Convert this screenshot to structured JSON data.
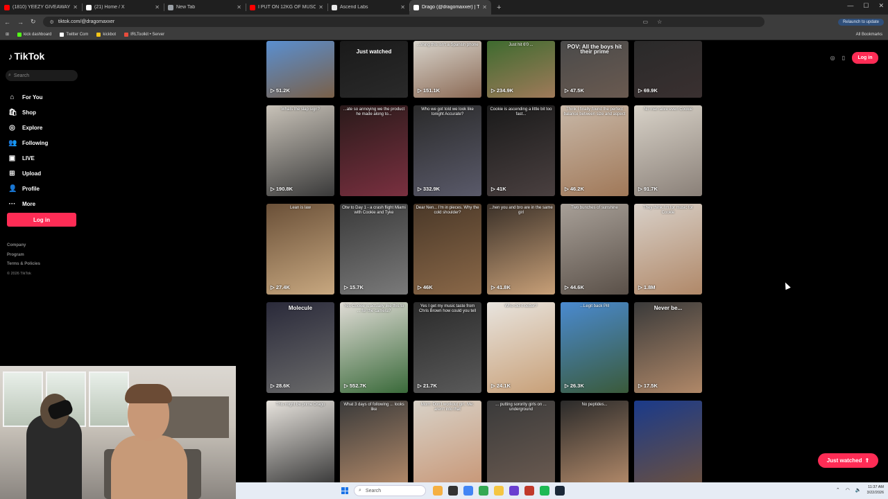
{
  "browser": {
    "tabs": [
      {
        "title": "(1810) YEEZY GIVEAWAY!!! | 67!",
        "color": "#ff0000",
        "active": false
      },
      {
        "title": "(21) Home / X",
        "color": "#ffffff",
        "active": false
      },
      {
        "title": "New Tab",
        "color": "#9aa0a6",
        "active": false
      },
      {
        "title": "I PUT ON 12KG OF MUSCLE IN",
        "color": "#ff0000",
        "active": false
      },
      {
        "title": "Ascend Labs",
        "color": "#e8e8e8",
        "active": false
      },
      {
        "title": "Drago (@dragomaxxer) | TikTok",
        "color": "#ffffff",
        "active": true
      }
    ],
    "new_tab": "+",
    "url": "tiktok.com/@dragomaxxer",
    "relaunch": "Relaunch to update",
    "bookmarks": [
      {
        "label": "kick dashboard",
        "color": "#53fc18"
      },
      {
        "label": "Twitter Com",
        "color": "#ffffff"
      },
      {
        "label": "kickbot",
        "color": "#f5c518"
      },
      {
        "label": "IRLToolkit • Server",
        "color": "#e74c3c"
      }
    ],
    "all_bookmarks": "All Bookmarks"
  },
  "sidebar": {
    "logo": "TikTok",
    "search_placeholder": "Search",
    "nav": [
      {
        "label": "For You",
        "icon": "home-icon",
        "glyph": "⌂"
      },
      {
        "label": "Shop",
        "icon": "shop-icon",
        "glyph": "🛍"
      },
      {
        "label": "Explore",
        "icon": "compass-icon",
        "glyph": "◎"
      },
      {
        "label": "Following",
        "icon": "following-icon",
        "glyph": "👥"
      },
      {
        "label": "LIVE",
        "icon": "live-icon",
        "glyph": "▣"
      },
      {
        "label": "Upload",
        "icon": "upload-icon",
        "glyph": "⊞"
      },
      {
        "label": "Profile",
        "icon": "profile-icon",
        "glyph": "👤"
      },
      {
        "label": "More",
        "icon": "more-icon",
        "glyph": "···"
      }
    ],
    "login": "Log in",
    "footer": [
      "Company",
      "Program",
      "Terms & Policies"
    ],
    "copyright": "© 2026 TikTok"
  },
  "header": {
    "login": "Log in"
  },
  "videos": [
    {
      "views": "51.2K",
      "caption": "",
      "c1": "#5a8fd0",
      "c2": "#7a6048"
    },
    {
      "views": "",
      "caption": "Just watched",
      "c1": "#1a1a1a",
      "c2": "#2a2a2a",
      "just_watched": true
    },
    {
      "views": "151.1K",
      "caption": "...shing this isn't a Spanish phone",
      "c1": "#d8d4cc",
      "c2": "#8b6a55"
    },
    {
      "views": "234.9K",
      "caption": "Just hit 6'0 ...",
      "c1": "#3e6b2f",
      "c2": "#a07a5a"
    },
    {
      "views": "47.5K",
      "caption": "POV: All the boys hit their prime",
      "c1": "#4a4a4a",
      "c2": "#6a5a50",
      "big": true
    },
    {
      "views": "69.9K",
      "caption": "",
      "c1": "#2a2a2a",
      "c2": "#3a3030"
    },
    {
      "views": "190.8K",
      "caption": "Whats the slap sign?",
      "c1": "#c8c2b8",
      "c2": "#3a3a3a"
    },
    {
      "views": "",
      "caption": "...ate so annoying we the product he made along to...",
      "c1": "#2a1a1a",
      "c2": "#7a3040"
    },
    {
      "views": "332.9K",
      "caption": "Who we got told we look like tonight Accurate?",
      "c1": "#2a2a2a",
      "c2": "#5a5a6a"
    },
    {
      "views": "41K",
      "caption": "Cookie is ascending a little bit too fast...",
      "c1": "#1a1a1a",
      "c2": "#4a4040"
    },
    {
      "views": "46.2K",
      "caption": "Think I finally found the perfect balance between size and aspect",
      "c1": "#c8b8a8",
      "c2": "#a07858"
    },
    {
      "views": "91.7K",
      "caption": "No man alive even Cookie",
      "c1": "#d8d2c8",
      "c2": "#8a8078"
    },
    {
      "views": "27.4K",
      "caption": "Lean is law",
      "c1": "#6a5038",
      "c2": "#c8a880"
    },
    {
      "views": "15.7K",
      "caption": "Otw to Day 1 - a crash flight Miami with Cookie and Tyke",
      "c1": "#3a3a3a",
      "c2": "#7a7a7a"
    },
    {
      "views": "46K",
      "caption": "Dear Nen... I'm in pieces. Why the cold shoulder?",
      "c1": "#4a3828",
      "c2": "#8a6848"
    },
    {
      "views": "41.8K",
      "caption": "...hen you and bro are in the same girl",
      "c1": "#3a3028",
      "c2": "#c8a078"
    },
    {
      "views": "44.6K",
      "caption": "Two bunches of sunshine",
      "c1": "#a8a098",
      "c2": "#5a5048"
    },
    {
      "views": "1.8M",
      "caption": "They think I'm for music for Cookie",
      "c1": "#d8d0c8",
      "c2": "#b08868"
    },
    {
      "views": "28.6K",
      "caption": "Molecule",
      "c1": "#2a2a3a",
      "c2": "#6a6a6a",
      "big": true
    },
    {
      "views": "552.7K",
      "caption": "Yes Cookie is actually like this to ... for the camera?",
      "c1": "#e0dcd6",
      "c2": "#3a6a3a"
    },
    {
      "views": "21.7K",
      "caption": "Yes I get my music taste from Chris Brown how could you tell",
      "c1": "#2a2a2a",
      "c2": "#5a5a5a"
    },
    {
      "views": "24.1K",
      "caption": "Who did it better?",
      "c1": "#e8e4de",
      "c2": "#c8a078"
    },
    {
      "views": "26.3K",
      "caption": "...Legit back Pill",
      "c1": "#4a8ad0",
      "c2": "#3a5a3a"
    },
    {
      "views": "17.5K",
      "caption": "Never be...",
      "c1": "#3a3a3a",
      "c2": "#b08868",
      "big": true
    },
    {
      "views": "",
      "caption": "This might be prime Drago",
      "c1": "#e8e4de",
      "c2": "#3a3a3a"
    },
    {
      "views": "",
      "caption": "What 3 days of following ... looks like",
      "c1": "#3a3a3a",
      "c2": "#b08868"
    },
    {
      "views": "",
      "caption": "Mom: Don't workout girl. Me: aren't into that",
      "c1": "#d8d2c8",
      "c2": "#c89878"
    },
    {
      "views": "",
      "caption": "... putting sorority girls on ... underground",
      "c1": "#3a3a3a",
      "c2": "#6a5a50"
    },
    {
      "views": "",
      "caption": "No peptides...",
      "c1": "#2a2a2a",
      "c2": "#b08868"
    },
    {
      "views": "",
      "caption": "",
      "c1": "#1a3a8a",
      "c2": "#6a5040"
    }
  ],
  "just_watched_button": "Just watched",
  "taskbar": {
    "search": "Search",
    "apps": [
      "#f5b042",
      "#333333",
      "#4285f4",
      "#34a853",
      "#f4c542",
      "#6a3fd0",
      "#c0392b",
      "#1db954",
      "#1b2838"
    ],
    "time": "11:37 AM",
    "date": "3/22/2026"
  }
}
